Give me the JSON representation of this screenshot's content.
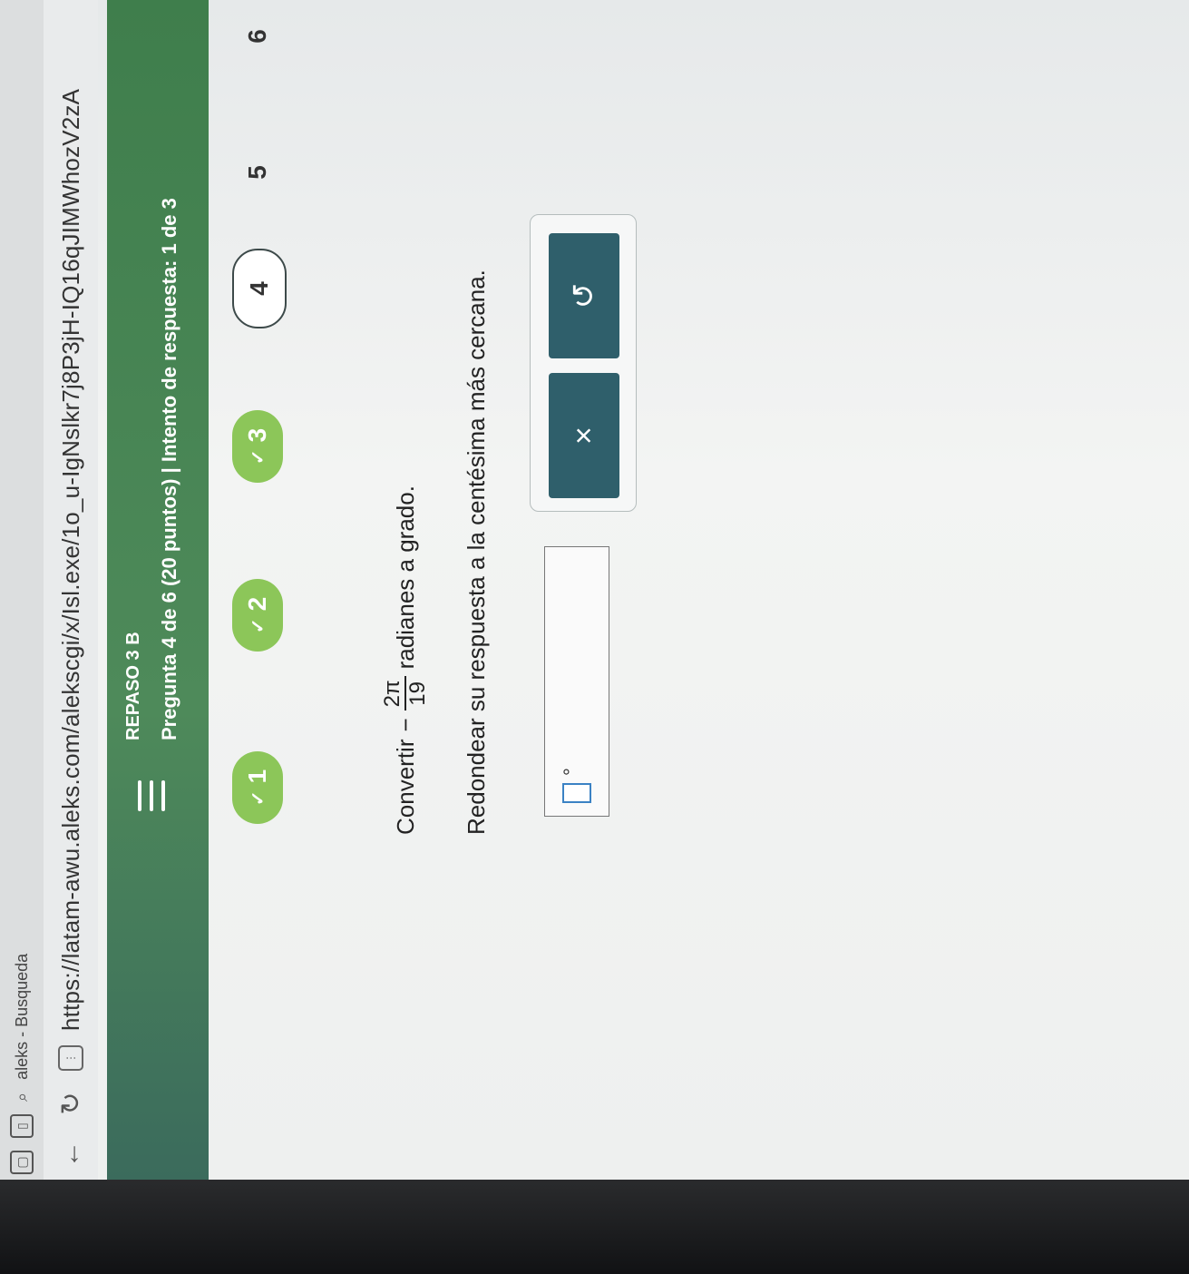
{
  "browser": {
    "tab_title": "aleks - Busqueda",
    "url": "https://latam-awu.aleks.com/alekscgi/x/Isl.exe/1o_u-IgNslkr7j8P3jH-IQ16qJIMWhozV2zA"
  },
  "header": {
    "assignment_title": "REPASO 3 B",
    "question_info": "Pregunta 4 de 6 (20 puntos)  |  Intento de respuesta: 1 de 3"
  },
  "progress": [
    {
      "label": "1",
      "state": "done"
    },
    {
      "label": "2",
      "state": "done"
    },
    {
      "label": "3",
      "state": "done"
    },
    {
      "label": "4",
      "state": "current"
    },
    {
      "label": "5",
      "state": "todo"
    },
    {
      "label": "6",
      "state": "todo"
    }
  ],
  "question": {
    "prefix": "Convertir",
    "sign": "−",
    "numerator": "2π",
    "denominator": "19",
    "suffix": "radianes a grado.",
    "instruction": "Redondear su respuesta a la centésima más cercana."
  },
  "answer": {
    "value": "",
    "unit": "°"
  },
  "tools": {
    "clear_label": "×",
    "undo_label": "↺"
  },
  "colors": {
    "header": "#4e8a5a",
    "done": "#8cc659",
    "tool_button": "#2f5f6b"
  }
}
